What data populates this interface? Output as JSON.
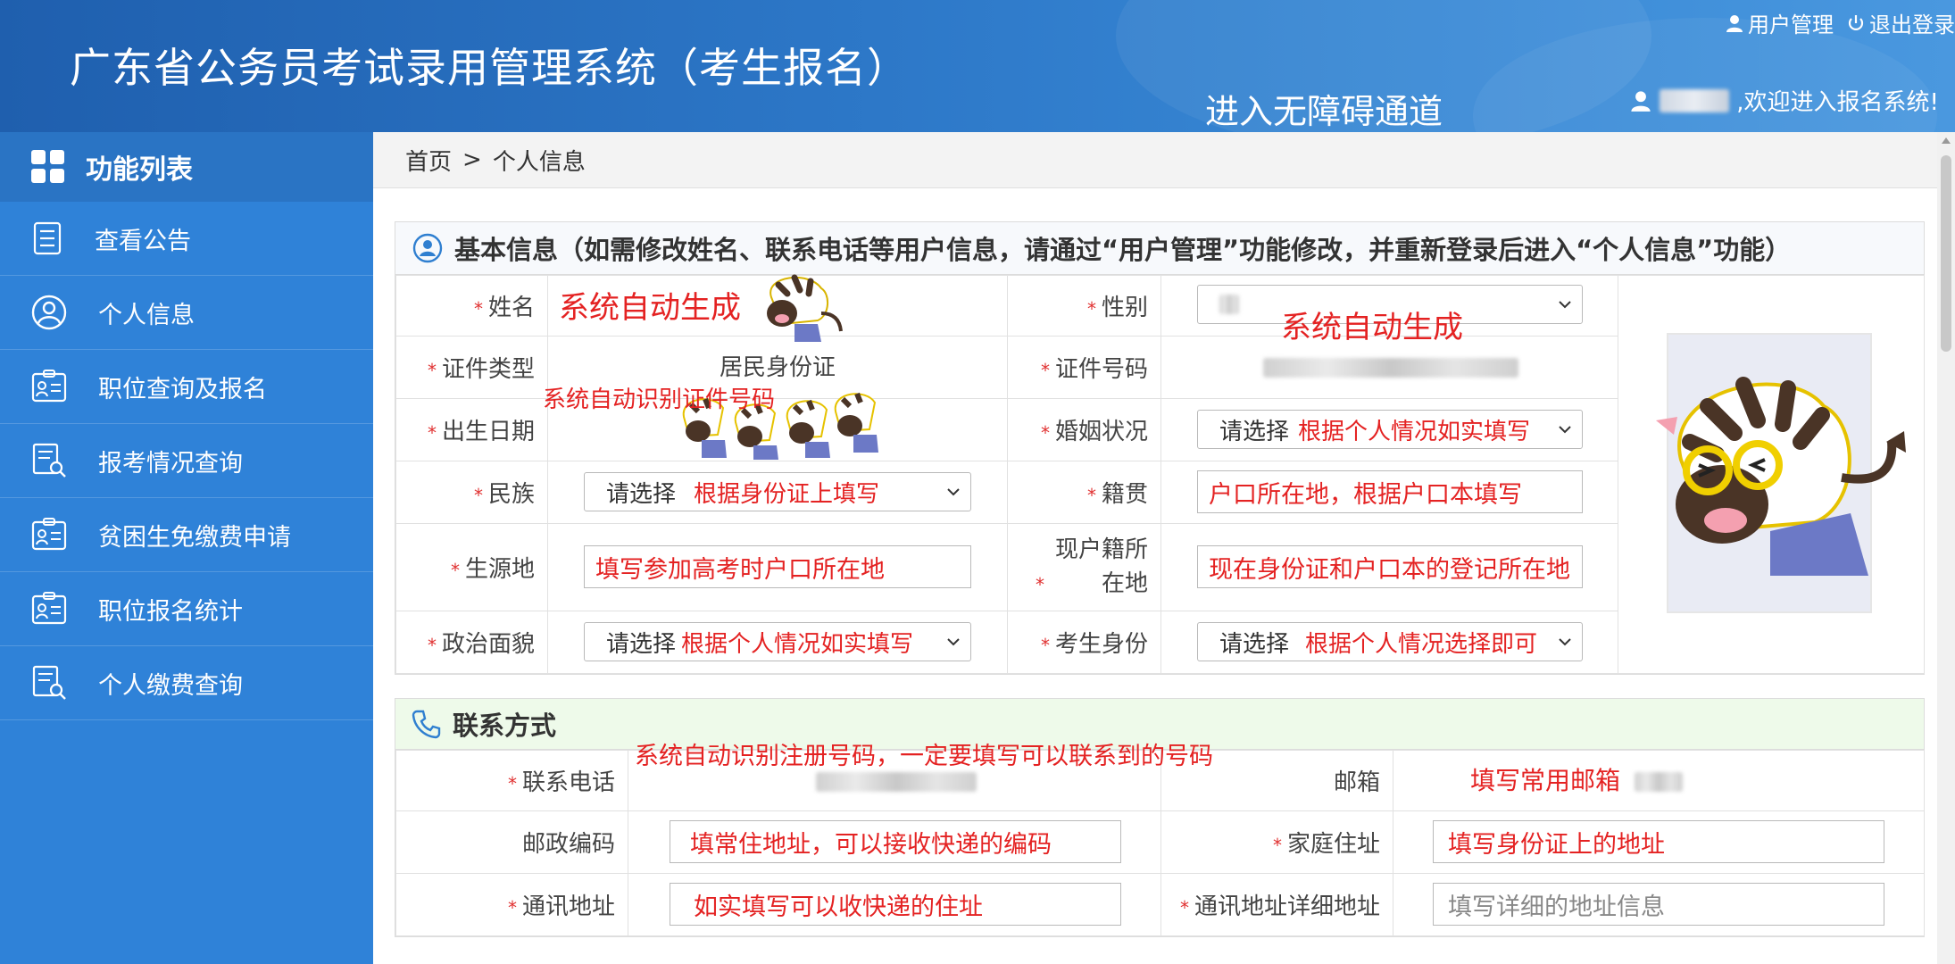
{
  "header": {
    "title": "广东省公务员考试录用管理系统（考生报名）",
    "user_mgmt": "用户管理",
    "logout": "退出登录",
    "accessibility": "进入无障碍通道",
    "welcome": ",欢迎进入报名系统!"
  },
  "sidebar": {
    "title": "功能列表",
    "items": [
      {
        "label": "查看公告",
        "icon": "list-icon"
      },
      {
        "label": "个人信息",
        "icon": "user-circle-icon"
      },
      {
        "label": "职位查询及报名",
        "icon": "id-card-icon"
      },
      {
        "label": "报考情况查询",
        "icon": "doc-search-icon"
      },
      {
        "label": "贫困生免缴费申请",
        "icon": "id-card-icon"
      },
      {
        "label": "职位报名统计",
        "icon": "id-card-icon"
      },
      {
        "label": "个人缴费查询",
        "icon": "doc-search-icon"
      }
    ]
  },
  "breadcrumb": {
    "home": "首页",
    "sep": ">",
    "current": "个人信息"
  },
  "basic": {
    "title": "基本信息（如需修改姓名、联系电话等用户信息，请通过“用户管理”功能修改，并重新登录后进入“个人信息”功能）",
    "name_label": "姓名",
    "name_note": "系统自动生成",
    "gender_label": "性别",
    "gender_note": "系统自动生成",
    "idtype_label": "证件类型",
    "idtype_value": "居民身份证",
    "idno_label": "证件号码",
    "idno_note": "系统自动识别证件号码",
    "birth_label": "出生日期",
    "marital_label": "婚姻状况",
    "marital_select": "请选择",
    "marital_note": "根据个人情况如实填写",
    "ethnic_label": "民族",
    "ethnic_select": "请选择",
    "ethnic_note": "根据身份证上填写",
    "native_label": "籍贯",
    "native_note": "户口所在地，根据户口本填写",
    "origin_label": "生源地",
    "origin_note": "填写参加高考时户口所在地",
    "hukou_label": "现户籍所在地",
    "hukou_note": "现在身份证和户口本的登记所在地",
    "political_label": "政治面貌",
    "political_select": "请选择",
    "political_note": "根据个人情况如实填写",
    "identity_label": "考生身份",
    "identity_select": "请选择",
    "identity_note": "根据个人情况选择即可"
  },
  "contact": {
    "title": "联系方式",
    "top_note": "系统自动识别注册号码，一定要填写可以联系到的号码",
    "phone_label": "联系电话",
    "email_label": "邮箱",
    "email_note": "填写常用邮箱",
    "postcode_label": "邮政编码",
    "postcode_note": "填常住地址，可以接收快递的编码",
    "home_label": "家庭住址",
    "home_note": "填写身份证上的地址",
    "mail_label": "通讯地址",
    "mail_note": "如实填写可以收快递的住址",
    "mail_detail_label": "通讯地址详细地址",
    "mail_detail_placeholder": "填写详细的地址信息"
  },
  "colors": {
    "header": "#2d78c8",
    "sidebar": "#2f82d8",
    "annotation": "#e42222",
    "contact_bg": "#eefaea"
  }
}
